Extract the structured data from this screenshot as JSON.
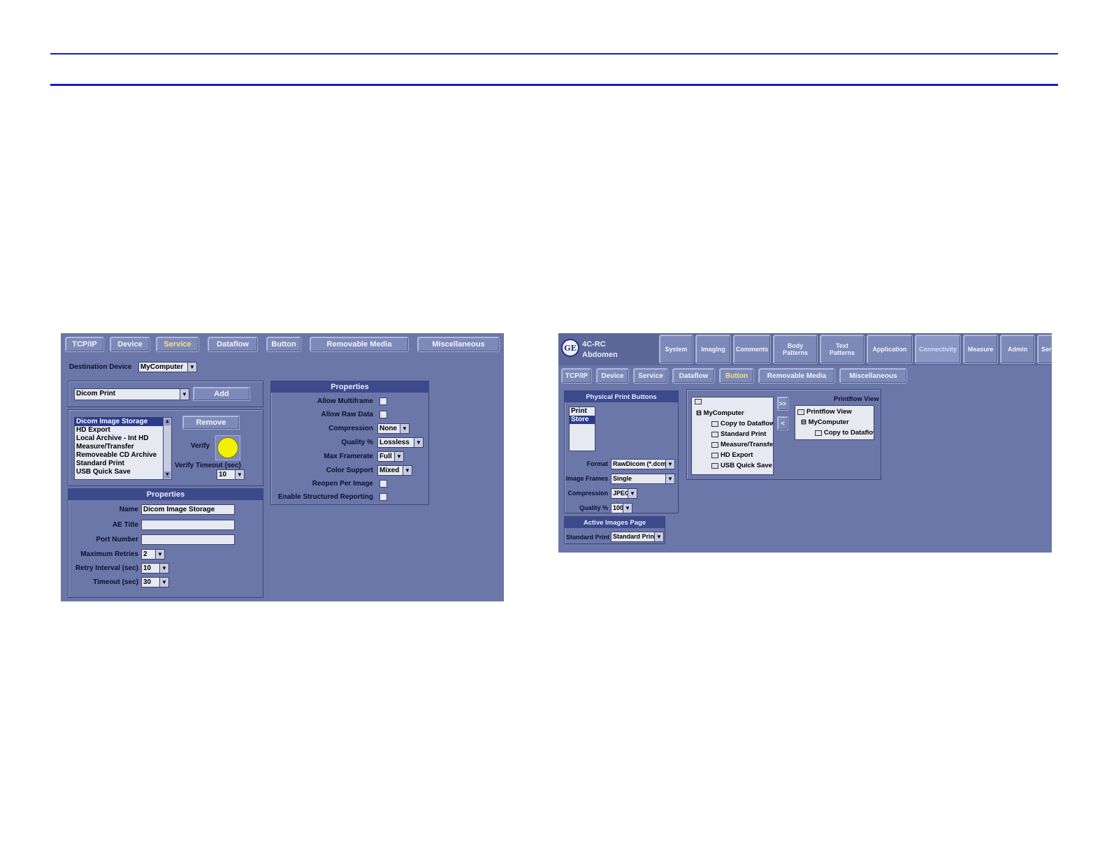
{
  "left": {
    "tabs": [
      "TCP/IP",
      "Device",
      "Service",
      "Dataflow",
      "Button",
      "Removable Media",
      "Miscellaneous"
    ],
    "active_tab": "Service",
    "destination_device": {
      "label": "Destination Device",
      "value": "MyComputer"
    },
    "service_select": {
      "value": "Dicom Print",
      "add_label": "Add"
    },
    "services_list": [
      "Dicom Image Storage",
      "HD Export",
      "Local Archive - Int HD",
      "Measure/Transfer",
      "Removeable CD Archive",
      "Standard Print",
      "USB Quick Save"
    ],
    "remove_label": "Remove",
    "verify_label": "Verify",
    "verify_timeout": {
      "label": "Verify Timeout (sec)",
      "value": "10"
    },
    "properties_left": {
      "header": "Properties",
      "name": {
        "label": "Name",
        "value": "Dicom Image Storage"
      },
      "ae_title": {
        "label": "AE Title",
        "value": ""
      },
      "port_number": {
        "label": "Port Number",
        "value": ""
      },
      "maximum_retries": {
        "label": "Maximum Retries",
        "value": "2"
      },
      "retry_interval": {
        "label": "Retry Interval (sec)",
        "value": "10"
      },
      "timeout": {
        "label": "Timeout (sec)",
        "value": "30"
      }
    },
    "properties_right": {
      "header": "Properties",
      "allow_multiframe": "Allow Multiframe",
      "allow_raw_data": "Allow Raw Data",
      "compression": {
        "label": "Compression",
        "value": "None"
      },
      "quality": {
        "label": "Quality %",
        "value": "Lossless"
      },
      "max_framerate": {
        "label": "Max Framerate",
        "value": "Full"
      },
      "color_support": {
        "label": "Color Support",
        "value": "Mixed"
      },
      "reopen_per_image": "Reopen Per Image",
      "enable_structured_reporting": "Enable Structured Reporting"
    }
  },
  "right": {
    "probe": "4C-RC",
    "preset": "Abdomen",
    "top_tabs": [
      "System",
      "Imaging",
      "Comments",
      "Body Patterns",
      "Text Patterns",
      "Application",
      "Connectivity",
      "Measure",
      "Admin",
      "Serv"
    ],
    "active_top_tab": "Connectivity",
    "sub_tabs": [
      "TCP/IP",
      "Device",
      "Service",
      "Dataflow",
      "Button",
      "Removable Media",
      "Miscellaneous"
    ],
    "active_sub_tab": "Button",
    "physical_print_buttons": {
      "header": "Physical Print Buttons",
      "items": [
        "Print",
        "Store"
      ],
      "selected": "Store"
    },
    "format": {
      "label": "Format",
      "value": "RawDicom (*.dcm)"
    },
    "image_frames": {
      "label": "Image Frames",
      "value": "Single"
    },
    "compression": {
      "label": "Compression",
      "value": "JPEG"
    },
    "quality": {
      "label": "Quality %",
      "value": "100"
    },
    "active_images_page": {
      "header": "Active Images Page",
      "label": "Standard Print",
      "value": "Standard Print"
    },
    "tree": {
      "root": "MyComputer",
      "items": [
        "Copy to Dataflow",
        "Standard Print",
        "Measure/Transfer",
        "HD Export",
        "USB Quick Save"
      ]
    },
    "move_right_label": ">>",
    "move_left_label": "<",
    "printflow": {
      "title": "Printflow View",
      "root": "Printflow View",
      "computer": "MyComputer",
      "child": "Copy to Dataflow"
    }
  },
  "colors": {
    "rule": "#1a1acc",
    "panel_bg": "#6b77a8",
    "header_bg": "#3c4a8c",
    "active_tab_text": "#f6e37a"
  }
}
